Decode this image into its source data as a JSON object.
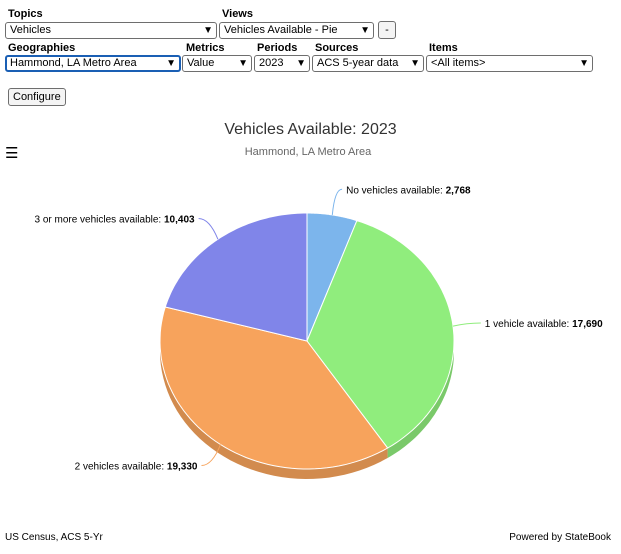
{
  "controls": {
    "topics": {
      "label": "Topics",
      "value": "Vehicles"
    },
    "views": {
      "label": "Views",
      "value": "Vehicles Available - Pie"
    },
    "remove_button": "-",
    "geographies": {
      "label": "Geographies",
      "value": "Hammond, LA Metro Area"
    },
    "metrics": {
      "label": "Metrics",
      "value": "Value"
    },
    "periods": {
      "label": "Periods",
      "value": "2023"
    },
    "sources": {
      "label": "Sources",
      "value": "ACS 5-year data"
    },
    "items": {
      "label": "Items",
      "value": "<All items>"
    },
    "configure_button": "Configure"
  },
  "menu_icon": "hamburger-icon",
  "chart_data": {
    "type": "pie",
    "title": "Vehicles Available: 2023",
    "subtitle": "Hammond, LA Metro Area",
    "slices": [
      {
        "label": "No vehicles available",
        "value": 2768,
        "display": "2,768",
        "color": "#7cb5ec"
      },
      {
        "label": "1 vehicle available",
        "value": 17690,
        "display": "17,690",
        "color": "#90ed7d"
      },
      {
        "label": "2 vehicles available",
        "value": 19330,
        "display": "19,330",
        "color": "#f7a35c"
      },
      {
        "label": "3 or more vehicles available",
        "value": 10403,
        "display": "10,403",
        "color": "#8085e9"
      }
    ]
  },
  "footer": {
    "source": "US Census, ACS 5-Yr",
    "powered_by": "Powered by StateBook"
  }
}
